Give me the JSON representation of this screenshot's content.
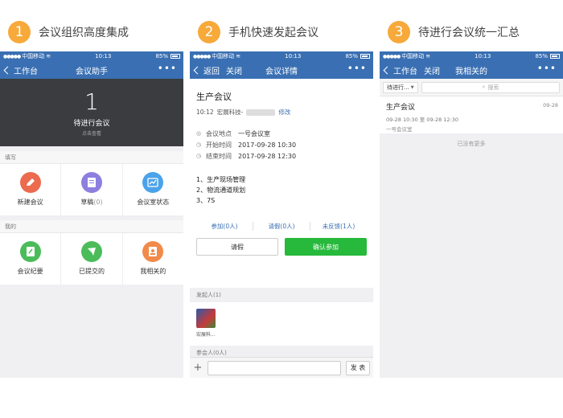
{
  "sections": [
    {
      "num": "1",
      "title": "会议组织高度集成"
    },
    {
      "num": "2",
      "title": "手机快速发起会议"
    },
    {
      "num": "3",
      "title": "待进行会议统一汇总"
    }
  ],
  "status": {
    "carrier": "中国移动",
    "time": "10:13",
    "battery": "85%"
  },
  "phone1": {
    "back": "工作台",
    "title": "会议助手",
    "more": "•••",
    "pending_count": "1",
    "pending_label": "待进行会议",
    "pending_hint": "点击查看",
    "section_fill": "填写",
    "fill_items": [
      {
        "label": "新建会议",
        "count": ""
      },
      {
        "label": "草稿",
        "count": "(0)"
      },
      {
        "label": "会议室状态",
        "count": ""
      }
    ],
    "section_mine": "我的",
    "mine_items": [
      {
        "label": "会议纪要"
      },
      {
        "label": "已提交的"
      },
      {
        "label": "我相关的"
      }
    ]
  },
  "phone2": {
    "back": "返回",
    "close": "关闭",
    "title": "会议详情",
    "more": "•••",
    "meeting_title": "生产会议",
    "time": "10:12",
    "org": "宏展科技-",
    "edit": "修改",
    "location_key": "会议地点",
    "location_val": "一号会议室",
    "start_key": "开始时间",
    "start_val": "2017-09-28 10:30",
    "end_key": "结束时间",
    "end_val": "2017-09-28 12:30",
    "agenda": [
      "1、生产现场管理",
      "2、物流通道规划",
      "3、7S"
    ],
    "count_join": "参加(0人)",
    "count_leave": "请假(0人)",
    "count_none": "未反馈(1人)",
    "btn_leave": "请假",
    "btn_confirm": "确认参加",
    "initiator_head": "发起人(1)",
    "initiator_name": "宏展科...",
    "participants_head": "参会人(0人)",
    "send": "发 表"
  },
  "phone3": {
    "back": "工作台",
    "close": "关闭",
    "title": "我相关的",
    "more": "•••",
    "filter": "待进行...",
    "search_placeholder": "搜索",
    "item_title": "生产会议",
    "item_date": "09-28",
    "item_time_start": "09-28 10:30",
    "item_time_sep": "至",
    "item_time_end": "09-28 12:30",
    "item_room": "一号会议室",
    "no_more": "已没有更多"
  },
  "colors": {
    "accent": "#3a70b3",
    "badge": "#f7a93a",
    "confirm": "#26b93b",
    "new_meeting_icon": "#ec6a4e",
    "draft_icon": "#8d7fe0",
    "room_icon": "#4aa3ea",
    "minutes_icon": "#4cbc5a",
    "submitted_icon": "#4cbc5a",
    "related_icon": "#f28a4a"
  },
  "icons": {
    "new_meeting": "pencil-icon",
    "draft": "document-icon",
    "room_status": "chart-icon",
    "minutes": "edit-note-icon",
    "submitted": "paper-plane-icon",
    "related": "person-card-icon"
  }
}
